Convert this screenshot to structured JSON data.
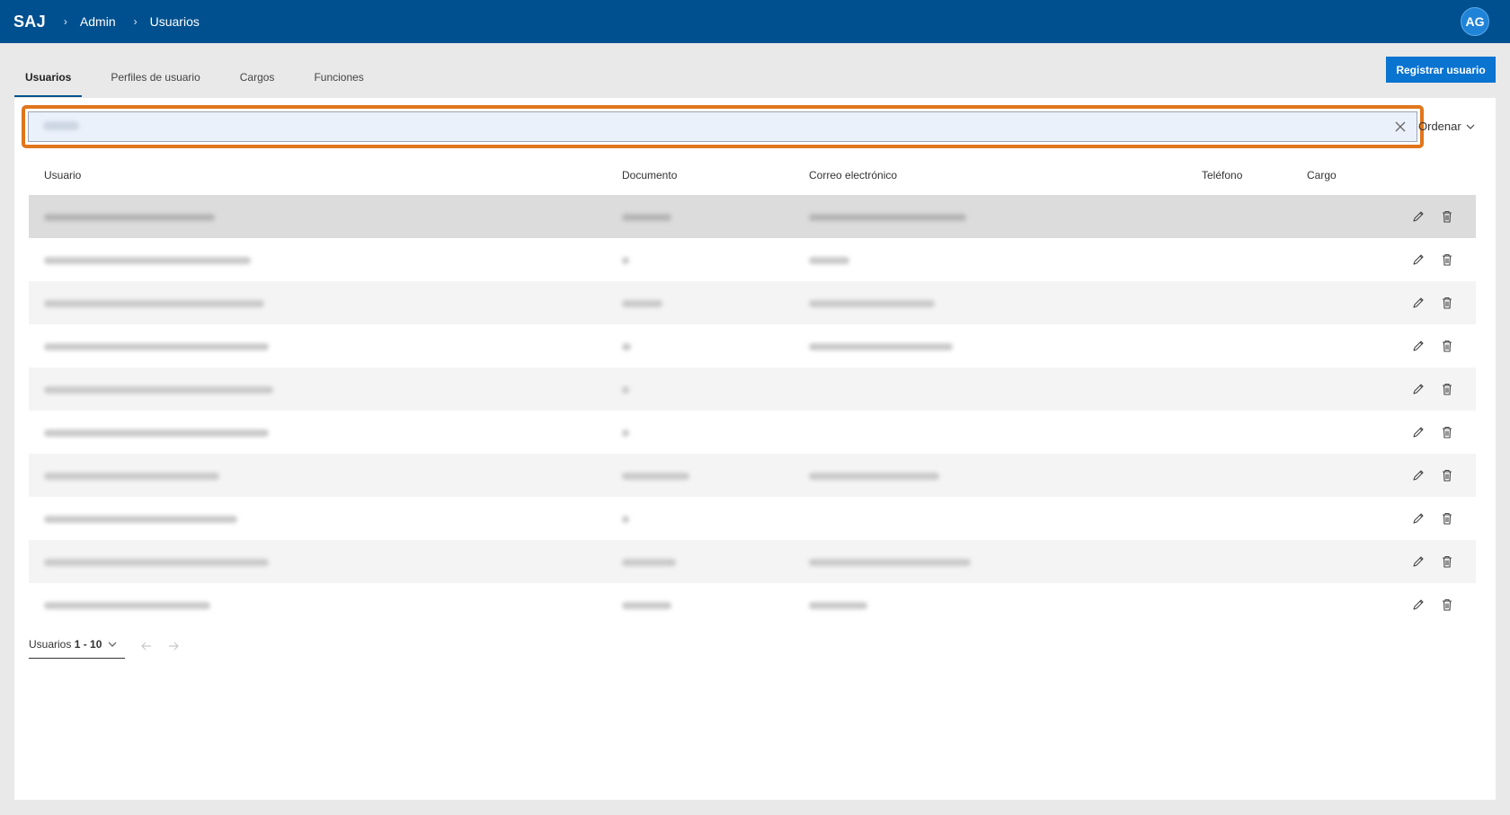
{
  "header": {
    "brand": "SAJ",
    "breadcrumb": [
      "Admin",
      "Usuarios"
    ],
    "avatar_initials": "AG"
  },
  "tabs": [
    "Usuarios",
    "Perfiles de usuario",
    "Cargos",
    "Funciones"
  ],
  "register_button": "Registrar usuario",
  "search": {
    "value": "",
    "placeholder": ""
  },
  "sort_label": "Ordenar",
  "table": {
    "columns": [
      "Usuario",
      "Documento",
      "Correo electrónico",
      "Teléfono",
      "Cargo"
    ],
    "row_count": 10,
    "selected_row": 0
  },
  "pagination": {
    "label": "Usuarios",
    "range": "1 - 10"
  },
  "colors": {
    "header_bg": "#00508f",
    "accent": "#0a74d1",
    "search_highlight": "#e0761b"
  },
  "icons": [
    "chevron-right-icon",
    "close-icon",
    "chevron-down-icon",
    "edit-pencil-icon",
    "trash-icon",
    "arrow-left-icon",
    "arrow-right-icon"
  ]
}
